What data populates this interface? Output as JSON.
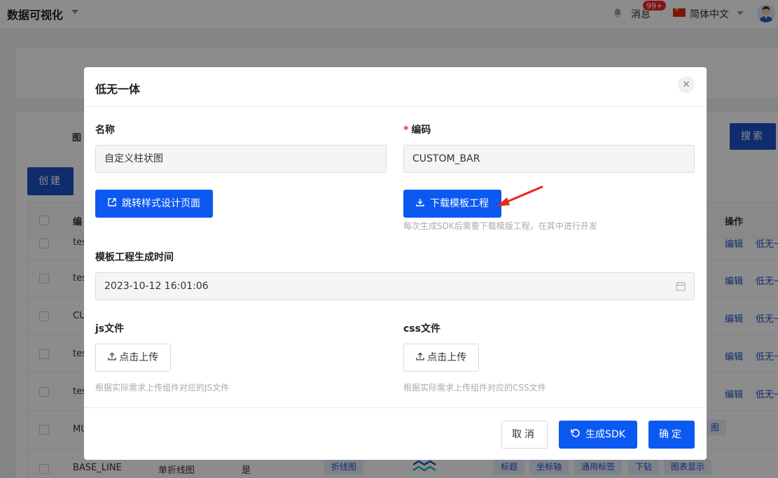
{
  "header": {
    "app_title": "数据可视化",
    "messages_label": "消息",
    "messages_badge": "99+",
    "language": "简体中文"
  },
  "background": {
    "filter_label": "图",
    "search_button": "搜索",
    "create_button": "创建",
    "table_head_first": "编",
    "table_head_op": "操作",
    "rows": [
      {
        "code": "tes",
        "edit": "编辑",
        "other": "低无一"
      },
      {
        "code": "tes",
        "edit": "编辑",
        "other": "低无一"
      },
      {
        "code": "CU",
        "edit": "编辑",
        "other": "低无一"
      },
      {
        "code": "tes",
        "edit": "编辑",
        "other": "低无一"
      },
      {
        "code": "tes",
        "edit": "编辑",
        "other": "低无一"
      },
      {
        "code": "MU",
        "edit": "",
        "other": ""
      }
    ],
    "last_row": {
      "code": "BASE_LINE",
      "name": "单折线图",
      "flag": "是",
      "type_tag": "折线图"
    },
    "tags": [
      "标题",
      "坐标轴",
      "通用标签",
      "下钻",
      "图表显示"
    ],
    "side_tag": "图"
  },
  "modal": {
    "title": "低无一体",
    "close_icon": "close-icon",
    "name_label": "名称",
    "name_value": "自定义柱状图",
    "code_label": "编码",
    "code_required_mark": "*",
    "code_value": "CUSTOM_BAR",
    "jump_button": "跳转样式设计页面",
    "download_button": "下载模板工程",
    "download_hint": "每次生成SDK后需要下载模版工程，在其中进行开发",
    "gen_time_label": "模板工程生成时间",
    "gen_time_value": "2023-10-12 16:01:06",
    "js_label": "js文件",
    "js_upload": "点击上传",
    "js_hint": "根据实际需求上传组件对应的JS文件",
    "css_label": "css文件",
    "css_upload": "点击上传",
    "css_hint": "根据实际需求上传组件对应的CSS文件",
    "cancel_button": "取消",
    "sdk_button": "生成SDK",
    "confirm_button": "确定"
  },
  "colors": {
    "primary": "#0c59f2",
    "danger": "#f5222d",
    "annotation_arrow": "#e8281e"
  }
}
